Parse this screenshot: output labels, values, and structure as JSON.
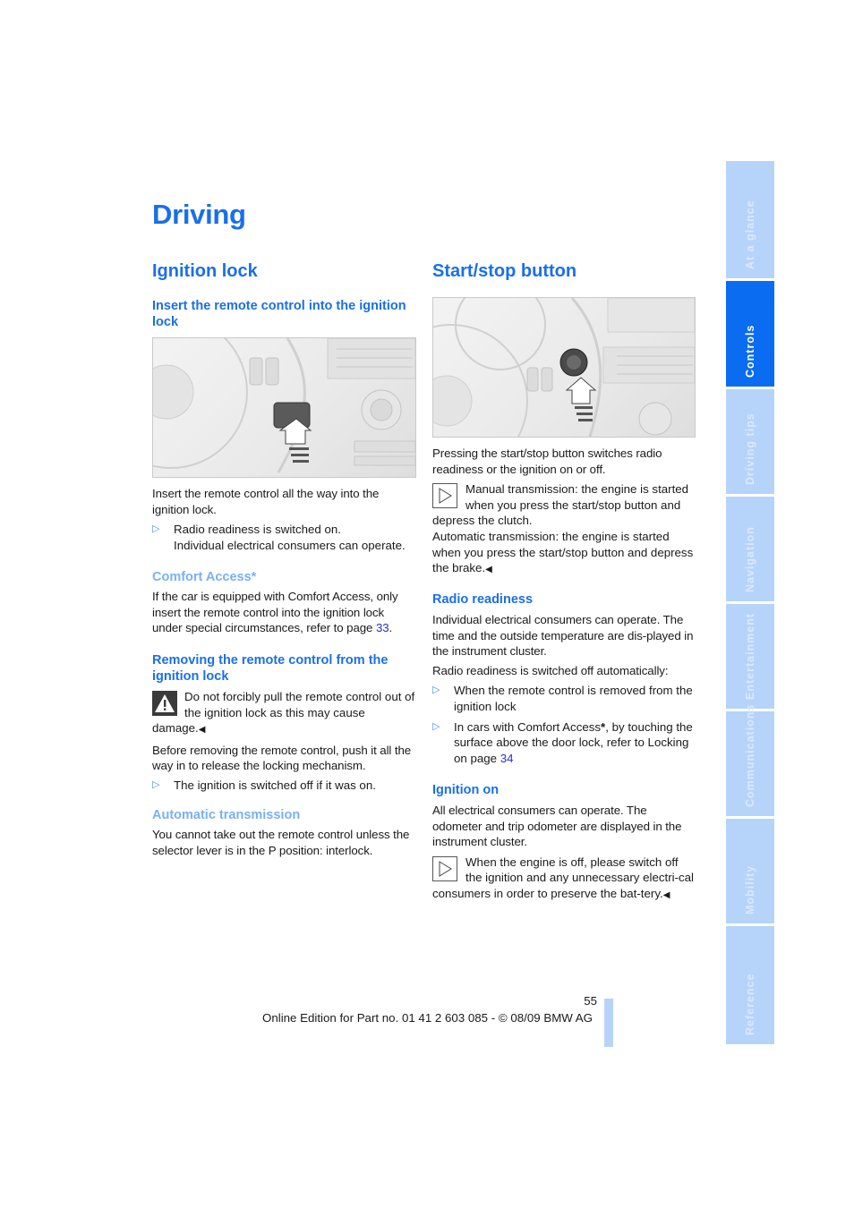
{
  "page": {
    "title": "Driving",
    "page_number": "55",
    "footer": "Online Edition for Part no. 01 41 2 603 085 - © 08/09 BMW AG"
  },
  "sidebar": {
    "tabs": [
      {
        "label": "At a glance",
        "active": false
      },
      {
        "label": "Controls",
        "active": true
      },
      {
        "label": "Driving tips",
        "active": false
      },
      {
        "label": "Navigation",
        "active": false
      },
      {
        "label": "Entertainment",
        "active": false
      },
      {
        "label": "Communications",
        "active": false
      },
      {
        "label": "Mobility",
        "active": false
      },
      {
        "label": "Reference",
        "active": false
      }
    ]
  },
  "left": {
    "heading": "Ignition lock",
    "insert": {
      "heading": "Insert the remote control into the ignition lock",
      "figure_alt": "Remote control being inserted into ignition lock next to steering wheel",
      "text": "Insert the remote control all the way into the ignition lock.",
      "bullet_line1": "Radio readiness is switched on.",
      "bullet_line2": "Individual electrical consumers can operate."
    },
    "comfort": {
      "heading": "Comfort Access*",
      "text": "If the car is equipped with Comfort Access, only insert the remote control into the ignition lock under special circumstances, refer to page ",
      "page_link": "33",
      "after_link": "."
    },
    "removing": {
      "heading": "Removing the remote control from the ignition lock",
      "warning": "Do not forcibly pull the remote control out of the ignition lock as this may cause damage.",
      "end_mark": "◀",
      "text": "Before removing the remote control, push it all the way in to release the locking mechanism.",
      "bullet": "The ignition is switched off if it was on."
    },
    "automatic": {
      "heading": "Automatic transmission",
      "text": "You cannot take out the remote control unless the selector lever is in the P position: interlock."
    }
  },
  "right": {
    "heading": "Start/stop button",
    "figure_alt": "Start/stop button on dashboard next to steering wheel",
    "intro": "Pressing the start/stop button switches radio readiness or the ignition on or off.",
    "note1": "Manual transmission: the engine is started when you press the start/stop button and depress the clutch.",
    "note1b": "Automatic transmission: the engine is started when you press the start/stop button and depress the brake.",
    "end_mark": "◀",
    "radio": {
      "heading": "Radio readiness",
      "text": "Individual electrical consumers can operate. The time and the outside temperature are dis-played in the instrument cluster.",
      "text2": "Radio readiness is switched off automatically:",
      "bullet1": "When the remote control is removed from the ignition lock",
      "bullet2_a": "In cars with Comfort Access",
      "bullet2_star": "*",
      "bullet2_b": ", by touching the surface above the door lock, refer to Locking on page ",
      "bullet2_link": "34"
    },
    "ignition": {
      "heading": "Ignition on",
      "text": "All electrical consumers can operate. The odometer and trip odometer are displayed in the instrument cluster.",
      "note": "When the engine is off, please switch off the ignition and any unnecessary electri-cal consumers in order to preserve the bat-tery."
    }
  },
  "icons": {
    "bullet": "▷",
    "note": "note-triangle-icon",
    "warning": "warning-icon"
  }
}
